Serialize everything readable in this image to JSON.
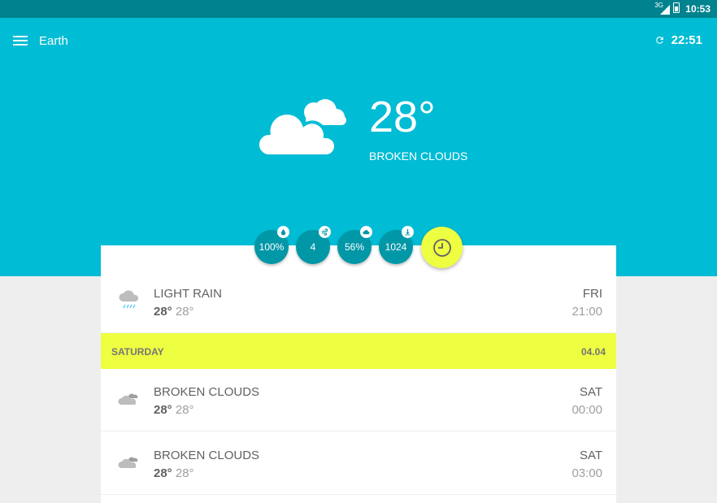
{
  "status_bar": {
    "signal": "3G",
    "time": "10:53"
  },
  "header": {
    "location": "Earth",
    "updated_time": "22:51"
  },
  "current": {
    "temperature": "28°",
    "condition": "BROKEN CLOUDS",
    "icon": "broken-clouds-icon"
  },
  "stats": {
    "humidity": "100%",
    "wind": "4",
    "clouds": "56%",
    "pressure": "1024"
  },
  "forecast_rows": [
    {
      "condition": "LIGHT RAIN",
      "high": "28°",
      "low": "28°",
      "day": "FRI",
      "time": "21:00",
      "icon": "light-rain-icon"
    },
    {
      "condition": "BROKEN CLOUDS",
      "high": "28°",
      "low": "28°",
      "day": "SAT",
      "time": "00:00",
      "icon": "broken-clouds-icon"
    },
    {
      "condition": "BROKEN CLOUDS",
      "high": "28°",
      "low": "28°",
      "day": "SAT",
      "time": "03:00",
      "icon": "broken-clouds-icon"
    }
  ],
  "day_header": {
    "label": "SATURDAY",
    "date": "04.04"
  },
  "colors": {
    "primary": "#00bcd4",
    "primary_dark": "#00838f",
    "chip": "#0097a7",
    "accent": "#eeff41"
  }
}
